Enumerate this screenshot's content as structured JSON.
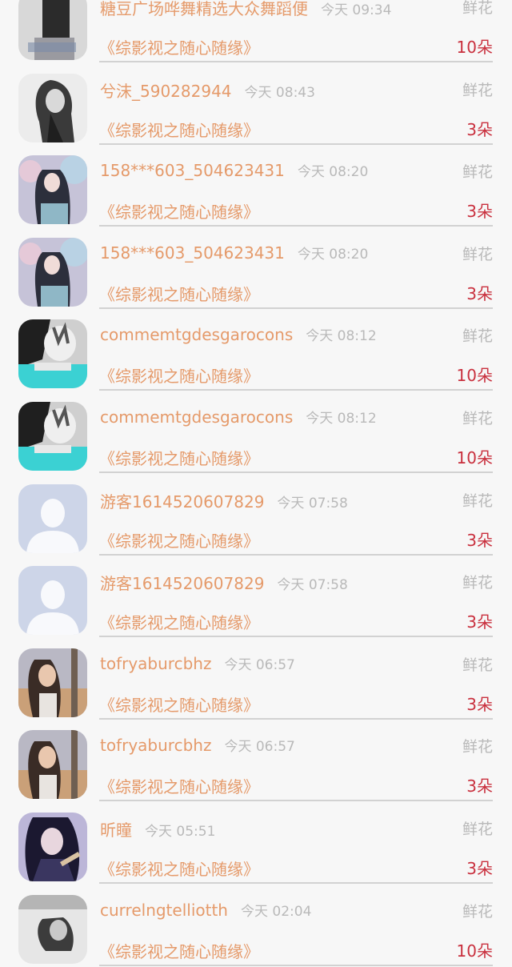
{
  "gift_list": [
    {
      "name": "糖豆广场哗舞精选大众舞蹈便",
      "time": "今天 09:34",
      "gift_type": "鲜花",
      "work": "《综影视之随心随缘》",
      "count": "10朵",
      "avatar": "photo-dark"
    },
    {
      "name": "兮沫_590282944",
      "time": "今天 08:43",
      "gift_type": "鲜花",
      "work": "《综影视之随心随缘》",
      "count": "3朵",
      "avatar": "photo-mono"
    },
    {
      "name": "158***603_504623431",
      "time": "今天 08:20",
      "gift_type": "鲜花",
      "work": "《综影视之随心随缘》",
      "count": "3朵",
      "avatar": "photo-pastel"
    },
    {
      "name": "158***603_504623431",
      "time": "今天 08:20",
      "gift_type": "鲜花",
      "work": "《综影视之随心随缘》",
      "count": "3朵",
      "avatar": "photo-pastel"
    },
    {
      "name": "commemtgdesgarocons",
      "time": "今天 08:12",
      "gift_type": "鲜花",
      "work": "《综影视之随心随缘》",
      "count": "10朵",
      "avatar": "photo-teal"
    },
    {
      "name": "commemtgdesgarocons",
      "time": "今天 08:12",
      "gift_type": "鲜花",
      "work": "《综影视之随心随缘》",
      "count": "10朵",
      "avatar": "photo-teal"
    },
    {
      "name": "游客1614520607829",
      "time": "今天 07:58",
      "gift_type": "鲜花",
      "work": "《综影视之随心随缘》",
      "count": "3朵",
      "avatar": "default-user"
    },
    {
      "name": "游客1614520607829",
      "time": "今天 07:58",
      "gift_type": "鲜花",
      "work": "《综影视之随心随缘》",
      "count": "3朵",
      "avatar": "default-user"
    },
    {
      "name": "tofryaburcbhz",
      "time": "今天 06:57",
      "gift_type": "鲜花",
      "work": "《综影视之随心随缘》",
      "count": "3朵",
      "avatar": "photo-warm"
    },
    {
      "name": "tofryaburcbhz",
      "time": "今天 06:57",
      "gift_type": "鲜花",
      "work": "《综影视之随心随缘》",
      "count": "3朵",
      "avatar": "photo-warm"
    },
    {
      "name": "昕瞳",
      "time": "今天 05:51",
      "gift_type": "鲜花",
      "work": "《综影视之随心随缘》",
      "count": "3朵",
      "avatar": "photo-anime"
    },
    {
      "name": "currelngtelliotth",
      "time": "今天 02:04",
      "gift_type": "鲜花",
      "work": "《综影视之随心随缘》",
      "count": "10朵",
      "avatar": "photo-gray"
    }
  ]
}
